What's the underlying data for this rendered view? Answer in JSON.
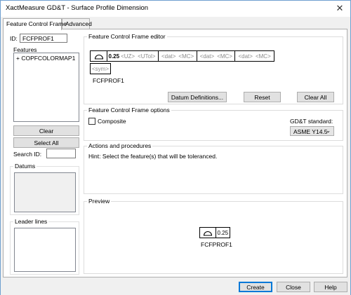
{
  "window": {
    "title": "XactMeasure GD&T - Surface Profile Dimension",
    "close_glyph": "✕"
  },
  "tabs": [
    {
      "label": "Feature Control Frame"
    },
    {
      "label": "Advanced"
    }
  ],
  "left": {
    "id_label": "ID:",
    "id_value": "FCFPROF1",
    "features_label": "Features",
    "features_items": [
      "+ COPFCOLORMAP1"
    ],
    "clear_label": "Clear",
    "select_all_label": "Select All",
    "search_id_label": "Search ID:",
    "search_id_value": "",
    "datums_label": "Datums",
    "leader_lines_label": "Leader lines"
  },
  "editor": {
    "title": "Feature Control Frame editor",
    "symbol_icon": "surface-profile-icon",
    "tolerance": "0.25",
    "uz": "<UZ>",
    "utol": "<UTol>",
    "datum_cells": [
      {
        "dat": "<dat>",
        "mc": "<MC>"
      },
      {
        "dat": "<dat>",
        "mc": "<MC>"
      },
      {
        "dat": "<dat>",
        "mc": "<MC>"
      }
    ],
    "sym_placeholder": "<sym>",
    "fcf_name": "FCFPROF1",
    "datum_definitions_label": "Datum Definitions...",
    "reset_label": "Reset",
    "clear_all_label": "Clear All"
  },
  "options": {
    "title": "Feature Control Frame options",
    "composite_label": "Composite",
    "composite_checked": false,
    "standard_label": "GD&T standard:",
    "standard_value": "ASME Y14.5",
    "chevron": "⌄"
  },
  "actions": {
    "title": "Actions and procedures",
    "hint": "Hint:  Select the feature(s) that will be toleranced."
  },
  "preview": {
    "title": "Preview",
    "tolerance": "0.25",
    "name": "FCFPROF1"
  },
  "footer": {
    "create_label": "Create",
    "close_label": "Close",
    "help_label": "Help"
  }
}
